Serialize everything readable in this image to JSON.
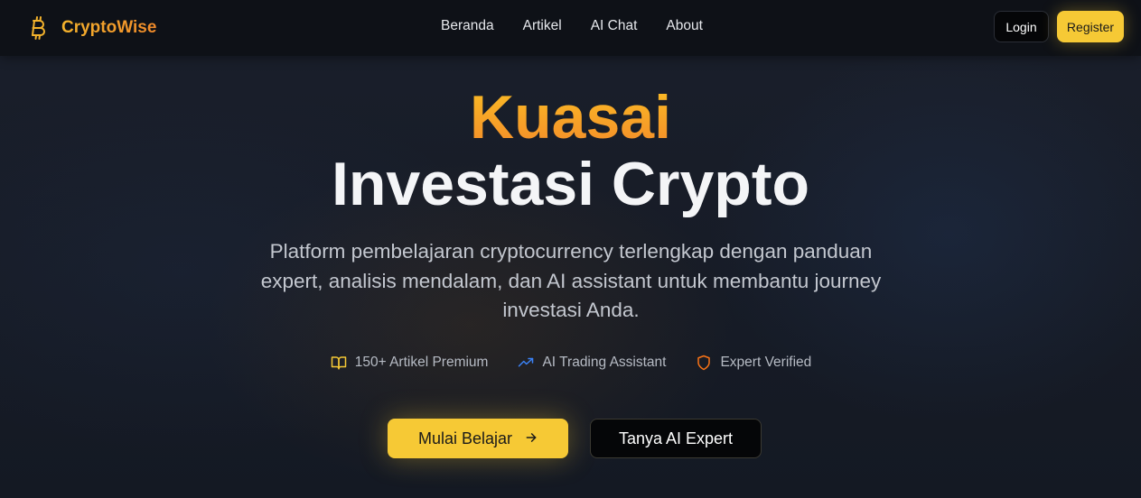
{
  "brand": {
    "name": "CryptoWise",
    "logo_icon": "bitcoin-icon",
    "accent": "#f4b32c"
  },
  "nav": {
    "links": [
      "Beranda",
      "Artikel",
      "AI Chat",
      "About"
    ],
    "login_label": "Login",
    "register_label": "Register"
  },
  "hero": {
    "title_highlight": "Kuasai",
    "title_main": "Investasi Crypto",
    "subtitle": "Platform pembelajaran cryptocurrency terlengkap dengan panduan expert, analisis mendalam, dan AI assistant untuk membantu journey investasi Anda.",
    "features": [
      {
        "icon": "book-open-icon",
        "label": "150+ Artikel Premium",
        "color": "#f6c935"
      },
      {
        "icon": "trending-up-icon",
        "label": "AI Trading Assistant",
        "color": "#3b82f6"
      },
      {
        "icon": "shield-icon",
        "label": "Expert Verified",
        "color": "#f97316"
      }
    ],
    "cta_primary": "Mulai Belajar",
    "cta_secondary": "Tanya AI Expert"
  },
  "colors": {
    "primary": "#f6c935",
    "background": "#151a24",
    "nav_bg": "#0e1117"
  }
}
